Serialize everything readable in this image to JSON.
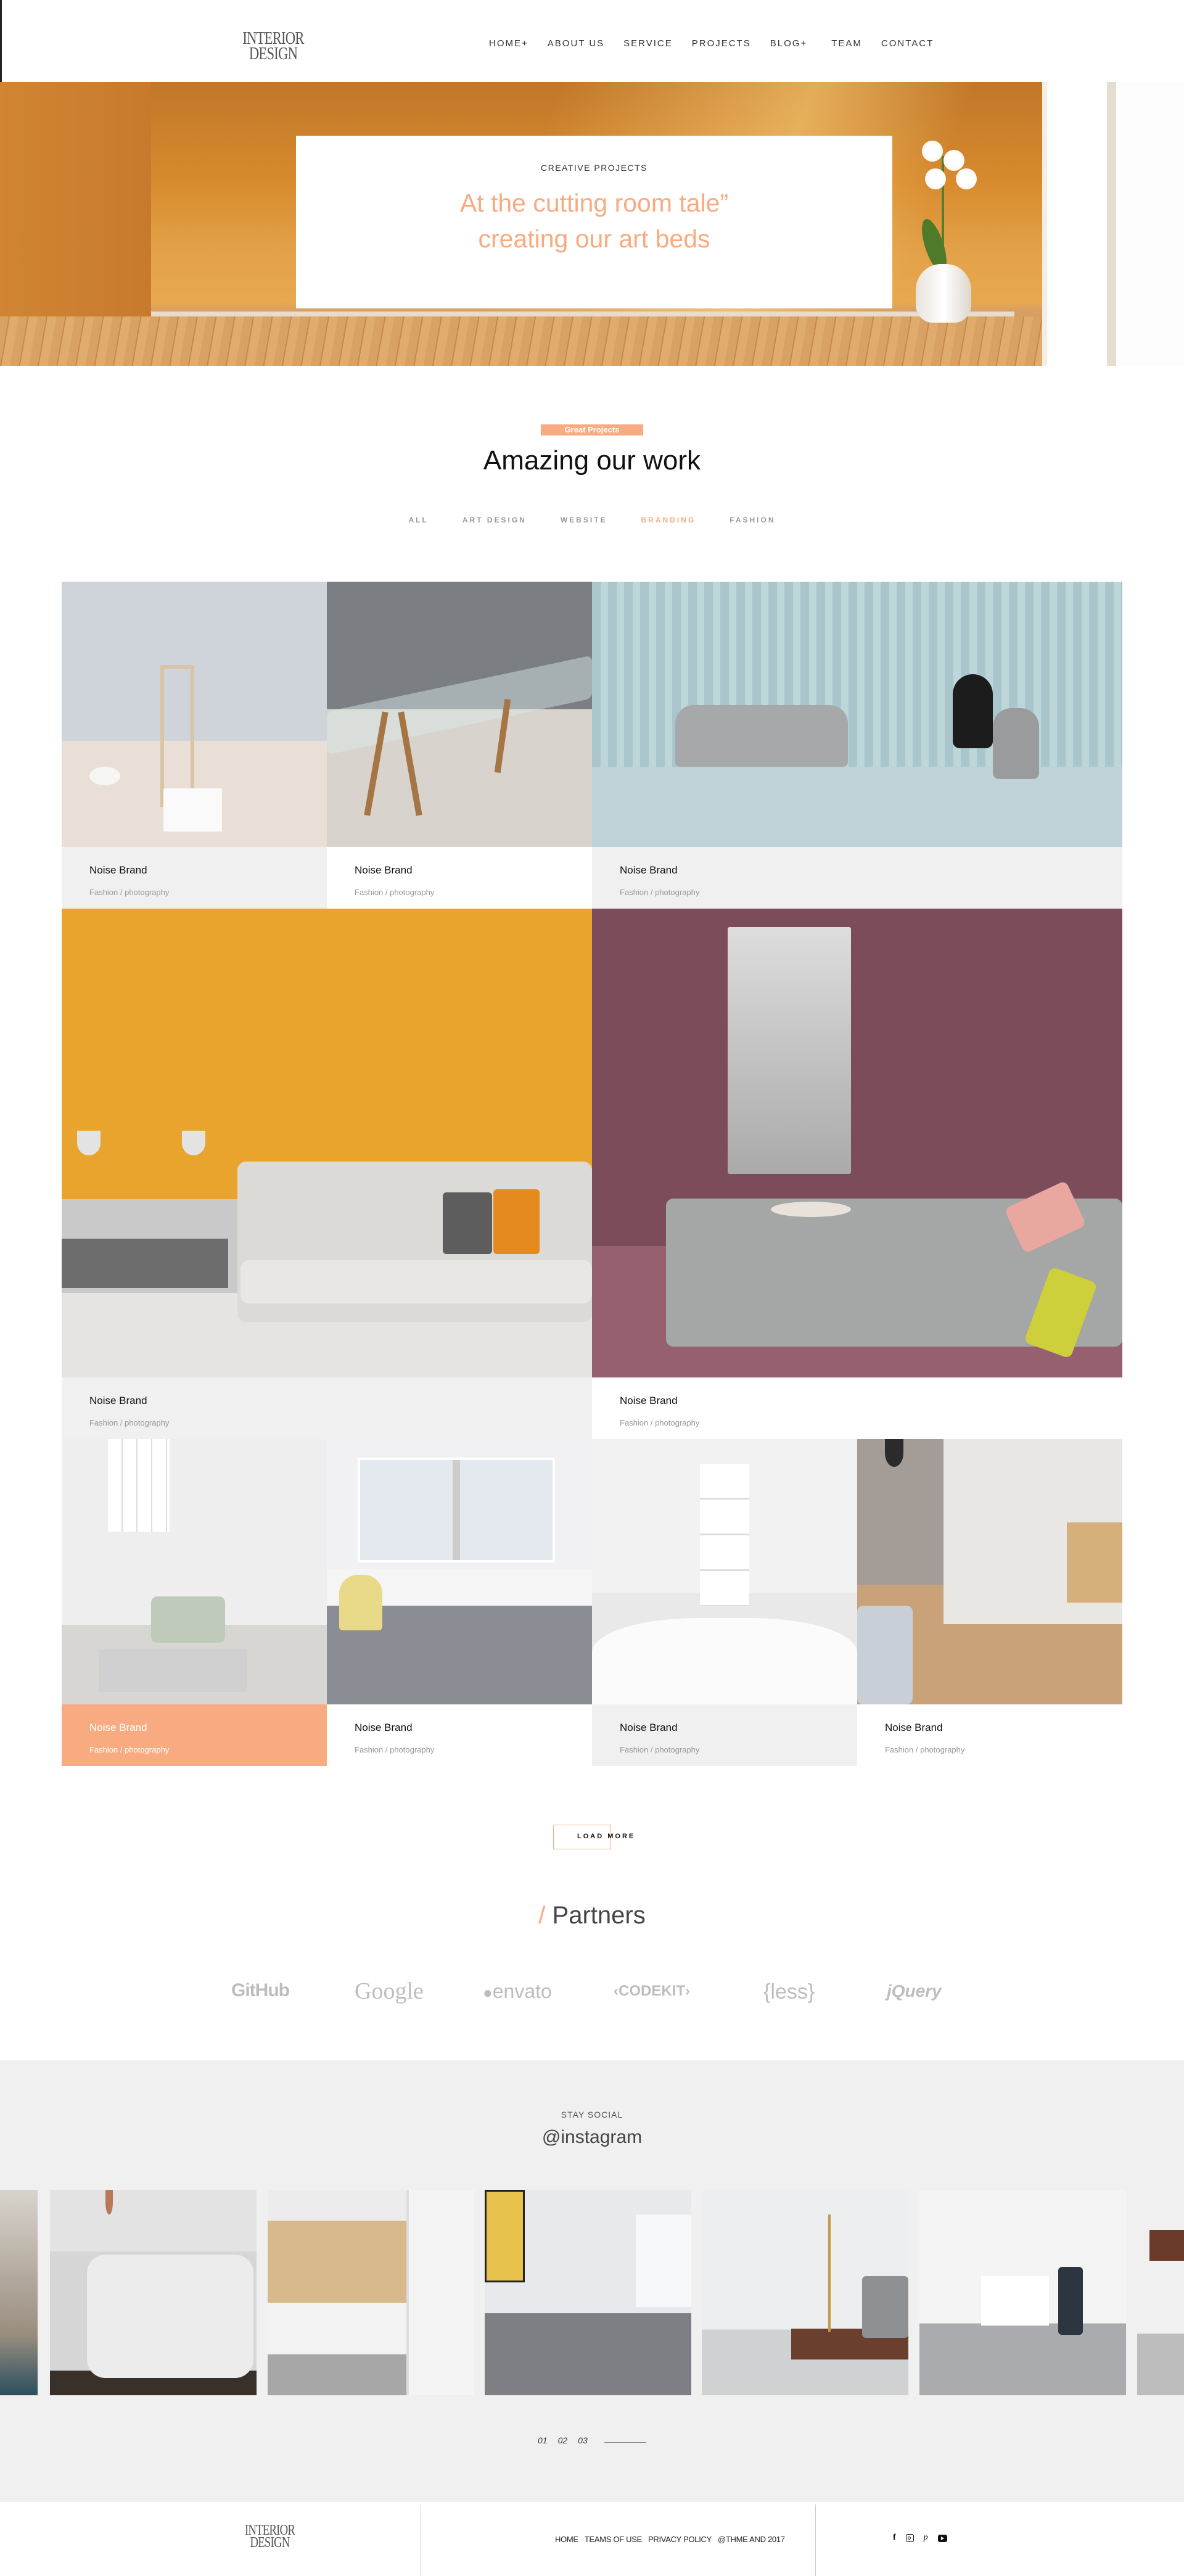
{
  "header": {
    "logo_line1": "INTERIOR",
    "logo_line2": "DESIGN",
    "nav": [
      "HOME+",
      "ABOUT US",
      "SERVICE",
      "PROJECTS",
      "BLOG+",
      "TEAM",
      "CONTACT"
    ]
  },
  "hero": {
    "kicker": "CREATIVE PROJECTS",
    "title_line1": "At the cutting room tale”",
    "title_line2": "creating our art beds"
  },
  "portfolio": {
    "badge": "Great Projects",
    "title": "Amazing our work",
    "filters": [
      {
        "label": "ALL",
        "active": false
      },
      {
        "label": "ART DESIGN",
        "active": false
      },
      {
        "label": "WEBSITE",
        "active": false
      },
      {
        "label": "BRANDING",
        "active": true
      },
      {
        "label": "FASHION",
        "active": false
      }
    ],
    "items": [
      {
        "title": "Noise Brand",
        "subtitle": "Fashion / photography",
        "image": "desk-lamp-shelf"
      },
      {
        "title": "Noise Brand",
        "subtitle": "Fashion / photography",
        "image": "glass-dining-table"
      },
      {
        "title": "Noise Brand",
        "subtitle": "Fashion / photography",
        "image": "grey-sofa-blue-wall"
      },
      {
        "title": "Noise Brand",
        "subtitle": "Fashion / photography",
        "image": "white-sofa-yellow-wall"
      },
      {
        "title": "Noise Brand",
        "subtitle": "Fashion / photography",
        "image": "grey-sofa-burgundy-wall"
      },
      {
        "title": "Noise Brand",
        "subtitle": "Fashion / photography",
        "image": "bright-living-room"
      },
      {
        "title": "Noise Brand",
        "subtitle": "Fashion / photography",
        "image": "bedroom-desk-window"
      },
      {
        "title": "Noise Brand",
        "subtitle": "Fashion / photography",
        "image": "white-bed-window"
      },
      {
        "title": "Noise Brand",
        "subtitle": "Fashion / photography",
        "image": "open-kitchen"
      }
    ],
    "load_more": "LOAD MORE"
  },
  "partners": {
    "slash": "/",
    "title": "Partners",
    "logos": [
      "GitHub",
      "Google",
      "envato",
      "‹CODEKIT›",
      "{less}",
      "jQuery"
    ]
  },
  "social": {
    "kicker": "STAY SOCIAL",
    "handle": "@instagram",
    "images": [
      "living-room-partial",
      "white-sofa-pillows",
      "kitchen-bar-stools",
      "bedroom-yellow-poster",
      "wooden-bench-lamp",
      "white-gallery-hall",
      "partial-shelf"
    ],
    "pager": [
      "01",
      "02",
      "03"
    ]
  },
  "footer": {
    "logo_line1": "INTERIOR",
    "logo_line2": "DESIGN",
    "links": [
      "HOME",
      "TEAMS OF USE",
      "PRIVACY POLICY",
      "@THME AND 2017"
    ],
    "social_icons": [
      "facebook-icon",
      "instagram-icon",
      "pinterest-icon",
      "youtube-icon"
    ]
  },
  "colors": {
    "accent": "#f8ab80",
    "grey_panel": "#f0f0f0",
    "text": "#222222"
  }
}
